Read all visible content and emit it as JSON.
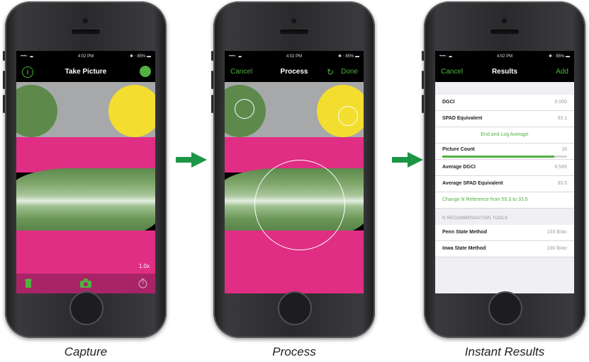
{
  "colors": {
    "accent_green": "#4fb13f",
    "arrow_green": "#1c9646",
    "magenta": "#e02e84",
    "leaf_green": "#5d8a4b",
    "yellow": "#f3dd2f",
    "gray_card": "#a7a8a9"
  },
  "captions": [
    "Capture",
    "Process",
    "Instant Results"
  ],
  "status_bar": {
    "carrier": "••••◦  ☁",
    "time": "4:02 PM",
    "battery": "✱ ‧ 85% ▬"
  },
  "capture": {
    "title": "Take Picture",
    "info_icon": "info-icon",
    "settings_icon": "gear-icon",
    "zoom_label": "1.0x",
    "toolbar": {
      "left_icon": "trash-icon",
      "center_icon": "camera-icon",
      "right_icon": "timer-icon"
    }
  },
  "process": {
    "cancel_label": "Cancel",
    "title": "Process",
    "refresh_icon": "refresh-icon",
    "done_label": "Done"
  },
  "results": {
    "cancel_label": "Cancel",
    "title": "Results",
    "add_label": "Add",
    "rows": {
      "dgci": {
        "label": "DGCI",
        "value": "0.000"
      },
      "spad": {
        "label": "SPAD Equivalent",
        "value": "33.1"
      },
      "end_log": {
        "label": "End and Log Average"
      },
      "picture_count": {
        "label": "Picture Count",
        "value": "16",
        "progress": 0.9
      },
      "avg_dgci": {
        "label": "Average DGCI",
        "value": "0.565"
      },
      "avg_spad": {
        "label": "Average SPAD Equivalent",
        "value": "33.5"
      },
      "change_ref": {
        "label": "Change N Reference from 55.3 to 33.5"
      }
    },
    "section_header": "N RECOMMENDATION TOOLS",
    "tools": [
      {
        "label": "Penn State Method",
        "value": "103 lb/ac"
      },
      {
        "label": "Iowa State Method",
        "value": "100 lb/ac"
      }
    ]
  }
}
